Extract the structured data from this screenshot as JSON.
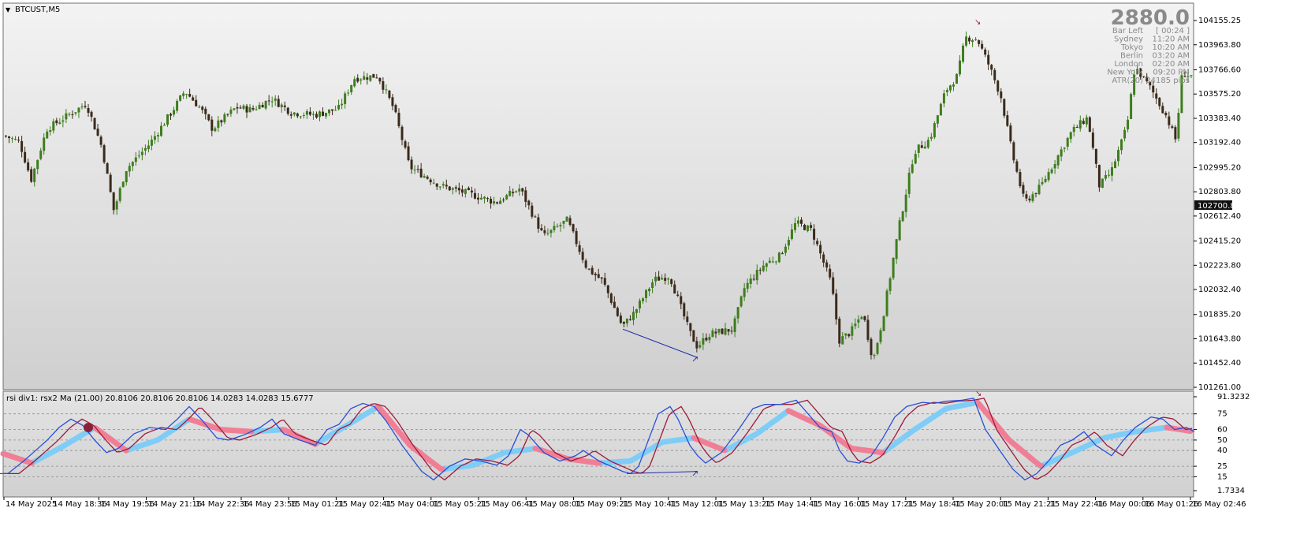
{
  "window": {
    "symbol_title": "BTCUST,M5",
    "arrow_icon": "triangle-down-icon"
  },
  "price_axis": {
    "ticks": [
      "104155.25",
      "103963.80",
      "103766.60",
      "103575.20",
      "103383.40",
      "103192.40",
      "102995.20",
      "102803.80",
      "102612.40",
      "102415.20",
      "102223.80",
      "102032.40",
      "101835.20",
      "101643.80",
      "101452.40",
      "101261.00"
    ],
    "current_price_label": "102700.85"
  },
  "info_panel": {
    "spread": "2880.0",
    "rows": [
      {
        "label": "Bar Left",
        "value": "[ 00:24 ]"
      },
      {
        "label": "Sydney",
        "value": "11:20 AM"
      },
      {
        "label": "Tokyo",
        "value": "10:20 AM"
      },
      {
        "label": "Berlin",
        "value": "03:20 AM"
      },
      {
        "label": "London",
        "value": "02:20 AM"
      },
      {
        "label": "New York",
        "value": "09:20 PM"
      },
      {
        "label": "ATR(20)",
        "value": "24185 pips"
      }
    ]
  },
  "indicator": {
    "label": "rsi div1: rsx2 Ma (21.00) 20.8106 20.8106 20.8106 14.0283 14.0283 15.6777",
    "levels": [
      "91.3232",
      "75",
      "60",
      "50",
      "40",
      "25",
      "15",
      "1.7334"
    ]
  },
  "time_axis": {
    "ticks": [
      "14 May 2025",
      "14 May 18:36",
      "14 May 19:56",
      "14 May 21:16",
      "14 May 22:36",
      "14 May 23:56",
      "15 May 01:21",
      "15 May 02:41",
      "15 May 04:01",
      "15 May 05:21",
      "15 May 06:41",
      "15 May 08:01",
      "15 May 09:21",
      "15 May 10:41",
      "15 May 12:01",
      "15 May 13:21",
      "15 May 14:41",
      "15 May 16:01",
      "15 May 17:21",
      "15 May 18:41",
      "15 May 20:01",
      "15 May 21:21",
      "15 May 22:41",
      "16 May 00:06",
      "16 May 01:26",
      "16 May 02:46"
    ]
  },
  "colors": {
    "bull_candle": "#3e7d1e",
    "bear_candle": "#3a2a1a",
    "rsx_line": "#2a4fd6",
    "signal_line": "#9c1b3a",
    "ma_up": "#7fcdf7",
    "ma_down": "#f07f96",
    "divergence": "#1f2fa8"
  },
  "chart_data": {
    "type": "candlestick",
    "price_path": [
      [
        0,
        103260
      ],
      [
        25,
        103200
      ],
      [
        40,
        102900
      ],
      [
        60,
        103300
      ],
      [
        90,
        103420
      ],
      [
        110,
        103500
      ],
      [
        130,
        103150
      ],
      [
        145,
        102650
      ],
      [
        160,
        102980
      ],
      [
        190,
        103180
      ],
      [
        220,
        103450
      ],
      [
        235,
        103600
      ],
      [
        255,
        103460
      ],
      [
        270,
        103300
      ],
      [
        300,
        103470
      ],
      [
        320,
        103450
      ],
      [
        345,
        103540
      ],
      [
        370,
        103430
      ],
      [
        400,
        103410
      ],
      [
        430,
        103460
      ],
      [
        450,
        103700
      ],
      [
        480,
        103720
      ],
      [
        500,
        103460
      ],
      [
        520,
        103000
      ],
      [
        560,
        102850
      ],
      [
        600,
        102780
      ],
      [
        630,
        102720
      ],
      [
        660,
        102830
      ],
      [
        690,
        102450
      ],
      [
        720,
        102580
      ],
      [
        745,
        102200
      ],
      [
        765,
        102100
      ],
      [
        790,
        101740
      ],
      [
        805,
        101850
      ],
      [
        830,
        102110
      ],
      [
        850,
        102140
      ],
      [
        875,
        101700
      ],
      [
        885,
        101580
      ],
      [
        900,
        101680
      ],
      [
        930,
        101720
      ],
      [
        945,
        102050
      ],
      [
        970,
        102230
      ],
      [
        990,
        102300
      ],
      [
        1010,
        102560
      ],
      [
        1030,
        102500
      ],
      [
        1055,
        102080
      ],
      [
        1065,
        101630
      ],
      [
        1080,
        101700
      ],
      [
        1095,
        101850
      ],
      [
        1108,
        101470
      ],
      [
        1120,
        101800
      ],
      [
        1140,
        102500
      ],
      [
        1160,
        103120
      ],
      [
        1180,
        103220
      ],
      [
        1200,
        103600
      ],
      [
        1215,
        103720
      ],
      [
        1225,
        104020
      ],
      [
        1240,
        104010
      ],
      [
        1255,
        103800
      ],
      [
        1270,
        103560
      ],
      [
        1285,
        103090
      ],
      [
        1300,
        102720
      ],
      [
        1320,
        102840
      ],
      [
        1340,
        103060
      ],
      [
        1360,
        103280
      ],
      [
        1380,
        103390
      ],
      [
        1395,
        102850
      ],
      [
        1410,
        102960
      ],
      [
        1430,
        103320
      ],
      [
        1440,
        103790
      ],
      [
        1460,
        103620
      ],
      [
        1480,
        103400
      ],
      [
        1492,
        103210
      ],
      [
        1500,
        103740
      ],
      [
        1510,
        103720
      ]
    ],
    "rsx_path": [
      [
        0,
        18
      ],
      [
        10,
        18
      ],
      [
        30,
        30
      ],
      [
        45,
        40
      ],
      [
        60,
        50
      ],
      [
        75,
        62
      ],
      [
        90,
        70
      ],
      [
        105,
        64
      ],
      [
        120,
        50
      ],
      [
        135,
        38
      ],
      [
        150,
        42
      ],
      [
        170,
        56
      ],
      [
        190,
        62
      ],
      [
        210,
        60
      ],
      [
        225,
        70
      ],
      [
        240,
        82
      ],
      [
        255,
        70
      ],
      [
        275,
        52
      ],
      [
        290,
        50
      ],
      [
        310,
        55
      ],
      [
        330,
        62
      ],
      [
        345,
        70
      ],
      [
        360,
        56
      ],
      [
        380,
        50
      ],
      [
        400,
        45
      ],
      [
        415,
        60
      ],
      [
        430,
        65
      ],
      [
        445,
        80
      ],
      [
        460,
        85
      ],
      [
        475,
        82
      ],
      [
        490,
        68
      ],
      [
        510,
        45
      ],
      [
        535,
        20
      ],
      [
        550,
        12
      ],
      [
        570,
        25
      ],
      [
        590,
        32
      ],
      [
        610,
        30
      ],
      [
        630,
        26
      ],
      [
        645,
        35
      ],
      [
        660,
        60
      ],
      [
        670,
        55
      ],
      [
        690,
        38
      ],
      [
        710,
        30
      ],
      [
        730,
        35
      ],
      [
        740,
        40
      ],
      [
        760,
        30
      ],
      [
        775,
        25
      ],
      [
        790,
        20
      ],
      [
        800,
        18
      ],
      [
        810,
        25
      ],
      [
        825,
        55
      ],
      [
        835,
        75
      ],
      [
        850,
        82
      ],
      [
        860,
        70
      ],
      [
        875,
        45
      ],
      [
        885,
        35
      ],
      [
        895,
        28
      ],
      [
        915,
        38
      ],
      [
        935,
        58
      ],
      [
        955,
        80
      ],
      [
        970,
        84
      ],
      [
        990,
        84
      ],
      [
        1010,
        88
      ],
      [
        1025,
        75
      ],
      [
        1040,
        62
      ],
      [
        1055,
        58
      ],
      [
        1065,
        40
      ],
      [
        1075,
        30
      ],
      [
        1090,
        28
      ],
      [
        1105,
        35
      ],
      [
        1120,
        52
      ],
      [
        1135,
        72
      ],
      [
        1150,
        82
      ],
      [
        1170,
        86
      ],
      [
        1185,
        85
      ],
      [
        1200,
        87
      ],
      [
        1220,
        88
      ],
      [
        1235,
        90
      ],
      [
        1250,
        60
      ],
      [
        1270,
        38
      ],
      [
        1285,
        22
      ],
      [
        1300,
        12
      ],
      [
        1315,
        18
      ],
      [
        1330,
        30
      ],
      [
        1345,
        45
      ],
      [
        1360,
        50
      ],
      [
        1375,
        58
      ],
      [
        1390,
        45
      ],
      [
        1410,
        35
      ],
      [
        1425,
        50
      ],
      [
        1440,
        62
      ],
      [
        1460,
        72
      ],
      [
        1475,
        70
      ],
      [
        1490,
        60
      ],
      [
        1505,
        62
      ],
      [
        1515,
        58
      ]
    ],
    "rsx_ma_path": [
      [
        0,
        38
      ],
      [
        40,
        28
      ],
      [
        80,
        44
      ],
      [
        120,
        62
      ],
      [
        160,
        40
      ],
      [
        200,
        50
      ],
      [
        240,
        70
      ],
      [
        280,
        60
      ],
      [
        320,
        58
      ],
      [
        360,
        60
      ],
      [
        400,
        46
      ],
      [
        440,
        64
      ],
      [
        480,
        82
      ],
      [
        520,
        45
      ],
      [
        560,
        22
      ],
      [
        600,
        26
      ],
      [
        640,
        38
      ],
      [
        680,
        42
      ],
      [
        720,
        32
      ],
      [
        760,
        28
      ],
      [
        800,
        30
      ],
      [
        840,
        48
      ],
      [
        880,
        52
      ],
      [
        920,
        40
      ],
      [
        960,
        56
      ],
      [
        1000,
        78
      ],
      [
        1040,
        64
      ],
      [
        1080,
        42
      ],
      [
        1120,
        38
      ],
      [
        1160,
        60
      ],
      [
        1200,
        80
      ],
      [
        1240,
        86
      ],
      [
        1280,
        50
      ],
      [
        1320,
        25
      ],
      [
        1360,
        38
      ],
      [
        1400,
        52
      ],
      [
        1440,
        58
      ],
      [
        1480,
        62
      ],
      [
        1515,
        58
      ]
    ],
    "price_divergence": {
      "from": [
        790,
        101720
      ],
      "to": [
        883,
        101500
      ]
    },
    "indicator_divergence": {
      "from": [
        795,
        18
      ],
      "to": [
        883,
        20
      ]
    }
  }
}
